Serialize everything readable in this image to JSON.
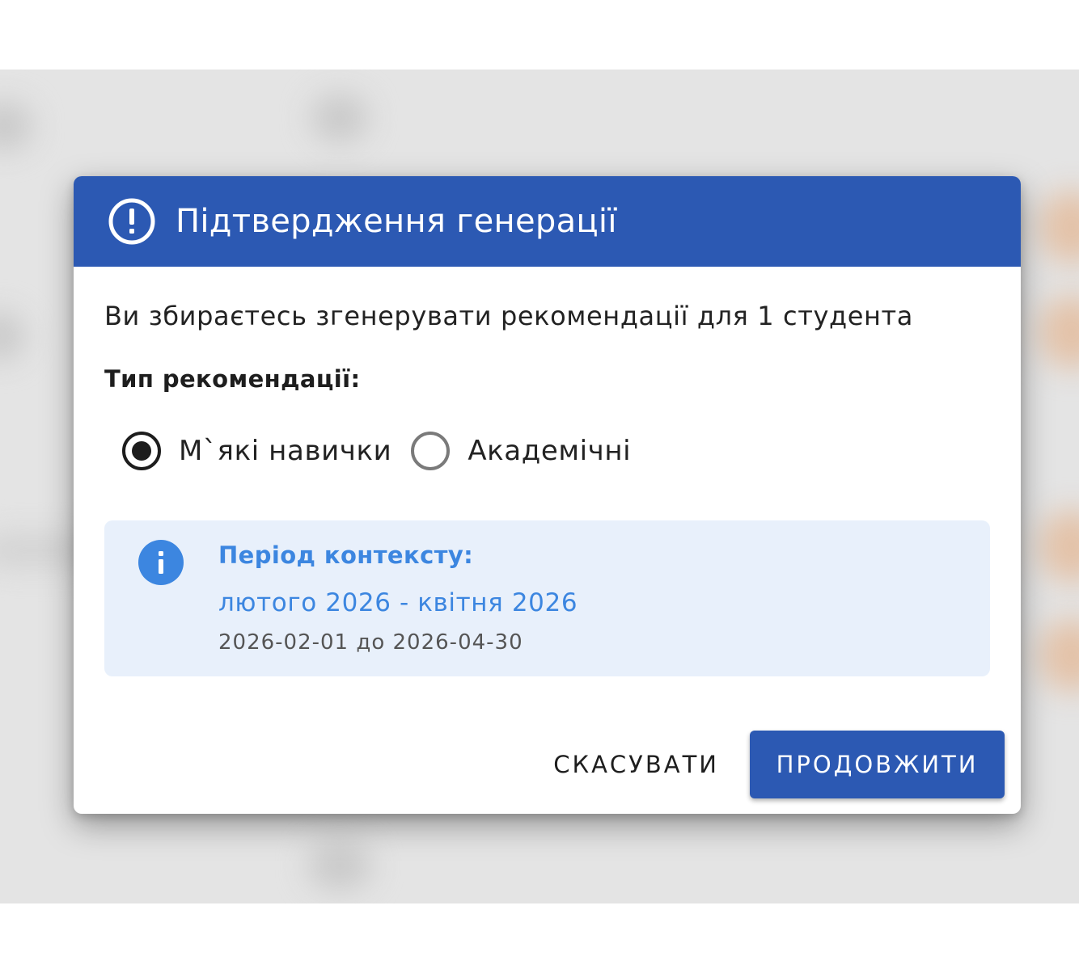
{
  "dialog": {
    "title": "Підтвердження генерації",
    "header_icon": "alert-circle-icon",
    "message": "Ви збираєтесь згенерувати рекомендації для 1 студента",
    "type_label": "Тип рекомендації:",
    "options": [
      {
        "label": "М`які навички",
        "checked": true
      },
      {
        "label": "Академічні",
        "checked": false
      }
    ],
    "info": {
      "icon": "info-icon",
      "title": "Період контексту:",
      "period": "лютого 2026 - квітня 2026",
      "range": "2026-02-01 до 2026-04-30"
    },
    "actions": {
      "cancel_label": "СКАСУВАТИ",
      "continue_label": "ПРОДОВЖИТИ"
    }
  },
  "colors": {
    "primary": "#2c59b3",
    "info_accent": "#3c86e0",
    "info_background": "#e8f0fb",
    "backdrop": "#e4e4e4"
  }
}
